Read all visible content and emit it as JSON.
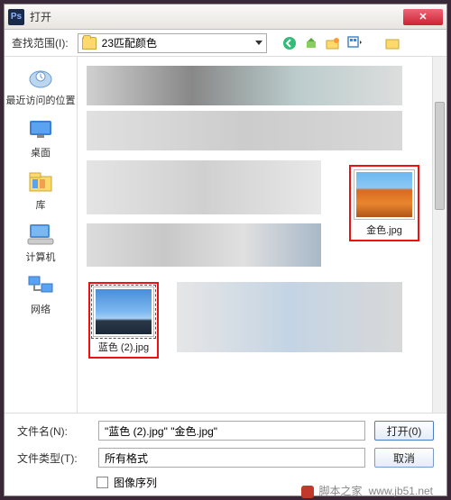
{
  "titlebar": {
    "title": "打开",
    "ps": "Ps"
  },
  "toolbar": {
    "lookin_label": "查找范围(I):",
    "current_folder": "23匹配颜色"
  },
  "sidebar": {
    "items": [
      {
        "label": "最近访问的位置"
      },
      {
        "label": "桌面"
      },
      {
        "label": "库"
      },
      {
        "label": "计算机"
      },
      {
        "label": "网络"
      }
    ]
  },
  "files": {
    "gold": {
      "caption": "金色.jpg"
    },
    "blue": {
      "caption": "蓝色 (2).jpg"
    }
  },
  "bottom": {
    "filename_label": "文件名(N):",
    "filename_value": "\"蓝色 (2).jpg\" \"金色.jpg\"",
    "filetype_label": "文件类型(T):",
    "filetype_value": "所有格式",
    "open_btn": "打开(0)",
    "cancel_btn": "取消",
    "image_sequence": "图像序列"
  },
  "watermark": {
    "text": "www.jb51.net",
    "brand": "脚本之家"
  }
}
